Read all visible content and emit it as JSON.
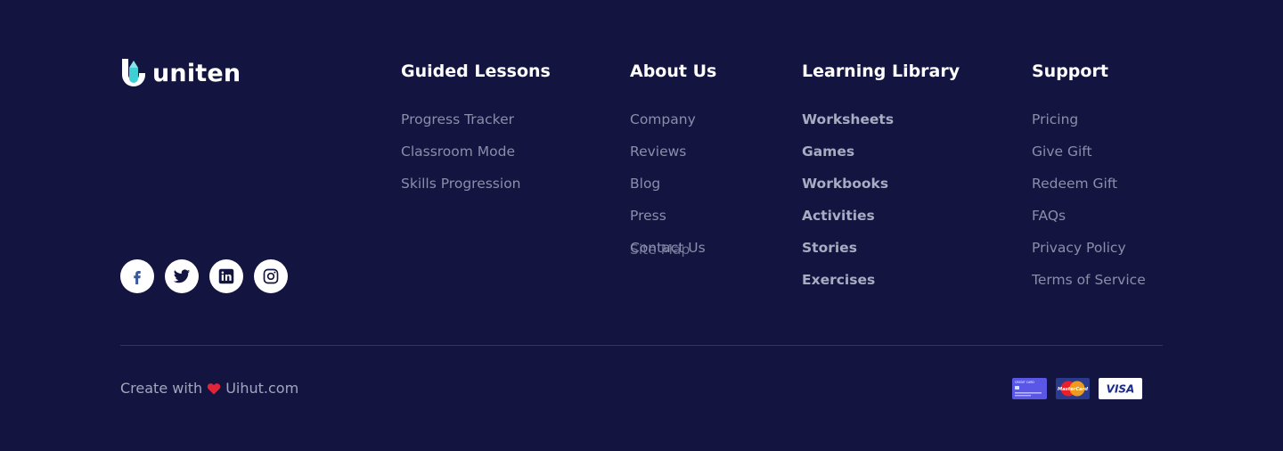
{
  "brand": {
    "name": "uniten"
  },
  "columns": [
    {
      "title": "Guided Lessons",
      "links": [
        "Progress Tracker",
        "Classroom Mode",
        "Skills Progression"
      ]
    },
    {
      "title": "About Us",
      "links": [
        "Company",
        "Reviews",
        "Blog",
        "Press"
      ],
      "overlap": [
        "Contact Us",
        "Site Map"
      ]
    },
    {
      "title": "Learning Library",
      "links": [
        "Worksheets",
        "Games",
        "Workbooks",
        "Activities",
        "Stories",
        "Exercises"
      ]
    },
    {
      "title": "Support",
      "links": [
        "Pricing",
        "Give Gift",
        "Redeem Gift",
        "FAQs",
        "Privacy Policy",
        "Terms of Service"
      ]
    }
  ],
  "social": [
    "facebook-icon",
    "twitter-icon",
    "linkedin-icon",
    "instagram-icon"
  ],
  "footer": {
    "credit_prefix": "Create with",
    "credit_site": "Uihut.com"
  },
  "payments": {
    "card_label": "CREDIT CARD",
    "mastercard_label": "MasterCard",
    "visa_label": "VISA"
  },
  "colors": {
    "background": "#131540",
    "heart": "#e0243a",
    "facebook": "#3b5998"
  }
}
